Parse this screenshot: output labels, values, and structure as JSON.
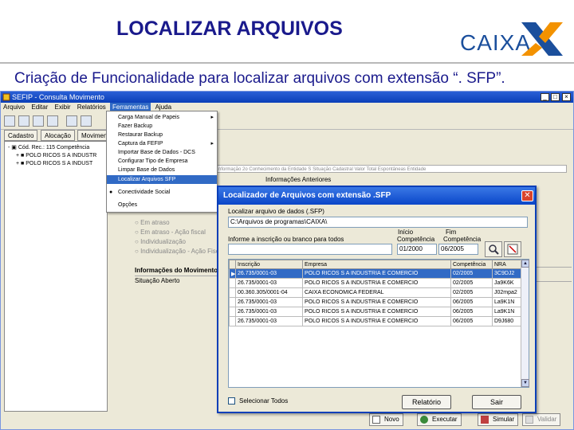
{
  "slide": {
    "title": "LOCALIZAR ARQUIVOS",
    "logo_text": "CAIXA",
    "subtitle": "Criação de Funcionalidade para localizar arquivos com extensão “. SFP”.",
    "colors": {
      "title": "#1a1a8c",
      "logo_blue": "#1b4f9c",
      "logo_orange": "#f39200"
    }
  },
  "app": {
    "title": "SEFIP - Consulta Movimento",
    "menu": [
      "Arquivo",
      "Editar",
      "Exibir",
      "Relatórios",
      "Ferramentas",
      "Ajuda"
    ],
    "tabs": [
      "Cadastro",
      "Alocação",
      "Movimento"
    ],
    "tree": [
      {
        "text": "Cód. Rec.: 115 Competência",
        "expander": "-"
      },
      {
        "text": "POLO RICOS S A INDUSTR",
        "expander": "+"
      },
      {
        "text": "POLO RICOS S A INDUST",
        "expander": "+"
      }
    ],
    "right_panel": {
      "field1": "nformação 2o Conhecimento da Entidade S Situação Cadastral Valor Total Espontâneas Entidade",
      "prior_info_label": "Informações Anteriores",
      "radio_labels": [
        "Em atraso",
        "Em atraso - Ação fiscal",
        "Individualização",
        "Individualização - Ação Fiscal"
      ],
      "movement_label": "Informações do Movimento",
      "situation_label": "Situação",
      "situation_value": "Aberto"
    },
    "bottom_buttons": [
      "Novo",
      "Executar",
      "Simular",
      "Validar"
    ]
  },
  "menu_dropdown": {
    "items": [
      {
        "label": "Carga Manual de Papeis",
        "arrow": "▸"
      },
      {
        "label": "Fazer Backup",
        "arrow": ""
      },
      {
        "label": "Restaurar Backup",
        "arrow": ""
      },
      {
        "label": "Captura da FEFIP",
        "arrow": "▸"
      },
      {
        "label": "Importar Base de Dados - DCS",
        "arrow": ""
      },
      {
        "label": "Configurar Tipo de Empresa",
        "arrow": ""
      },
      {
        "label": "Limpar Base de Dados",
        "arrow": ""
      },
      {
        "label": "Localizar Arquivos SFP",
        "arrow": "",
        "highlighted": true
      },
      {
        "label": "Conectividade Social",
        "arrow": ""
      },
      {
        "label": "Opções",
        "arrow": ""
      }
    ]
  },
  "dialog": {
    "title": "Localizador de Arquivos com extensão .SFP",
    "location_label": "Localizar arquivo de dados (.SFP)",
    "location_value": "C:\\Arquivos de programas\\CAIXA\\",
    "cnpj_label": "Informe a inscrição ou branco para todos",
    "start_label_top": "Início",
    "start_label_bottom": "Competência",
    "end_label_top": "Fim",
    "end_label_bottom": "Competência",
    "start_value": "01/2000",
    "end_value": "06/2005",
    "columns": [
      "Inscrição",
      "Empresa",
      "Competência",
      "NRA"
    ],
    "rows": [
      {
        "mark": "▶",
        "inscricao": "26.735/0001-03",
        "empresa": "POLO RICOS S A INDUSTRIA E COMERCIO",
        "competencia": "02/2005",
        "nra": "3C9DJ2"
      },
      {
        "mark": "",
        "inscricao": "26.735/0001-03",
        "empresa": "POLO RICOS S A INDUSTRIA E COMERCIO",
        "competencia": "02/2005",
        "nra": "Ja9K6K"
      },
      {
        "mark": "",
        "inscricao": "00.360.305/0001-04",
        "empresa": "CAIXA ECONOMICA FEDERAL",
        "competencia": "02/2005",
        "nra": "J02mpa2"
      },
      {
        "mark": "",
        "inscricao": "26.735/0001-03",
        "empresa": "POLO RICOS S A INDUSTRIA E COMERCIO",
        "competencia": "06/2005",
        "nra": "La9K1N"
      },
      {
        "mark": "",
        "inscricao": "26.735/0001-03",
        "empresa": "POLO RICOS S A INDUSTRIA E COMERCIO",
        "competencia": "06/2005",
        "nra": "La9K1N"
      },
      {
        "mark": "",
        "inscricao": "26.735/0001-03",
        "empresa": "POLO RICOS S A INDUSTRIA E COMERCIO",
        "competencia": "06/2005",
        "nra": "D9J680"
      }
    ],
    "select_all_label": "Selecionar Todos",
    "report_button": "Relatório",
    "exit_button": "Sair"
  }
}
